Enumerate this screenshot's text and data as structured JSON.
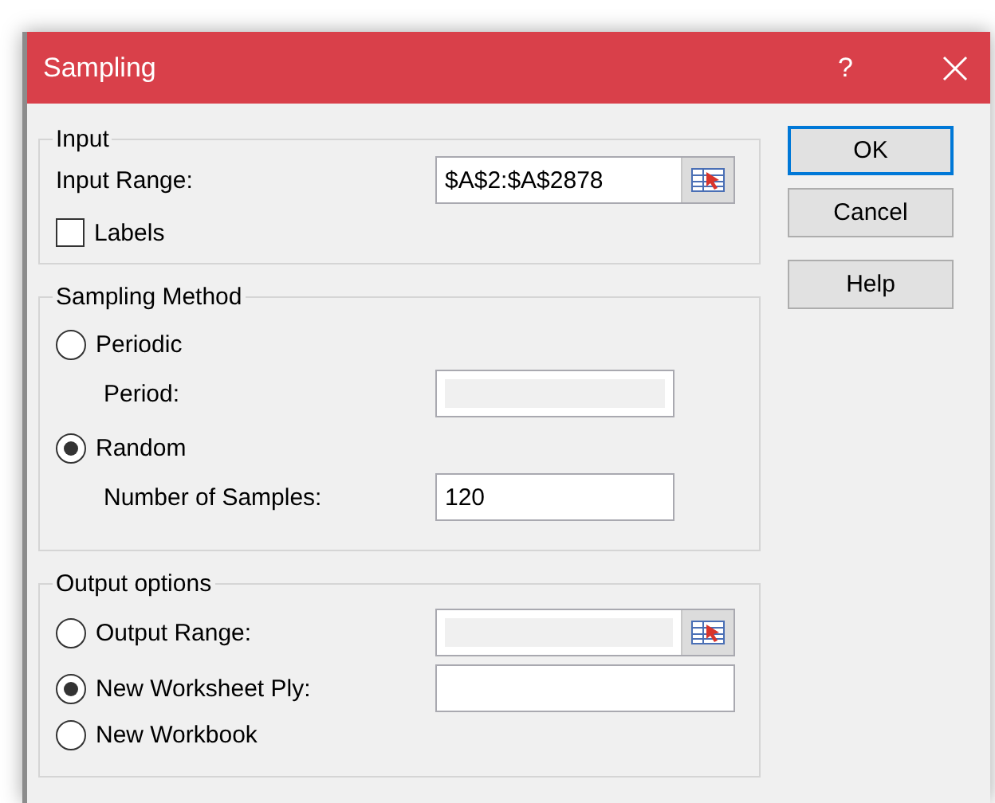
{
  "window": {
    "title": "Sampling",
    "help": "?"
  },
  "input": {
    "legend": "Input",
    "range": {
      "label": "Input Range:",
      "value": "$A$2:$A$2878",
      "picker": true,
      "disabled": false
    },
    "labels": {
      "label": "Labels",
      "checked": false
    }
  },
  "sampling_method": {
    "legend": "Sampling Method",
    "options": [
      {
        "label": "Periodic",
        "selected": false,
        "field": {
          "label": "Period:",
          "disabled": true
        }
      },
      {
        "label": "Random",
        "selected": true,
        "field": {
          "label": "Number of Samples:",
          "value": "120",
          "disabled": false
        }
      }
    ]
  },
  "output_options": {
    "legend": "Output options",
    "options": [
      {
        "label": "Output Range:",
        "selected": false,
        "field": {
          "disabled": true,
          "picker": true
        }
      },
      {
        "label": "New Worksheet Ply:",
        "selected": true,
        "field": {
          "disabled": false
        }
      },
      {
        "label": "New Workbook",
        "selected": false
      }
    ]
  },
  "buttons": [
    {
      "label": "OK",
      "default": true
    },
    {
      "label": "Cancel",
      "default": false
    },
    {
      "label": "Help",
      "default": false
    }
  ]
}
